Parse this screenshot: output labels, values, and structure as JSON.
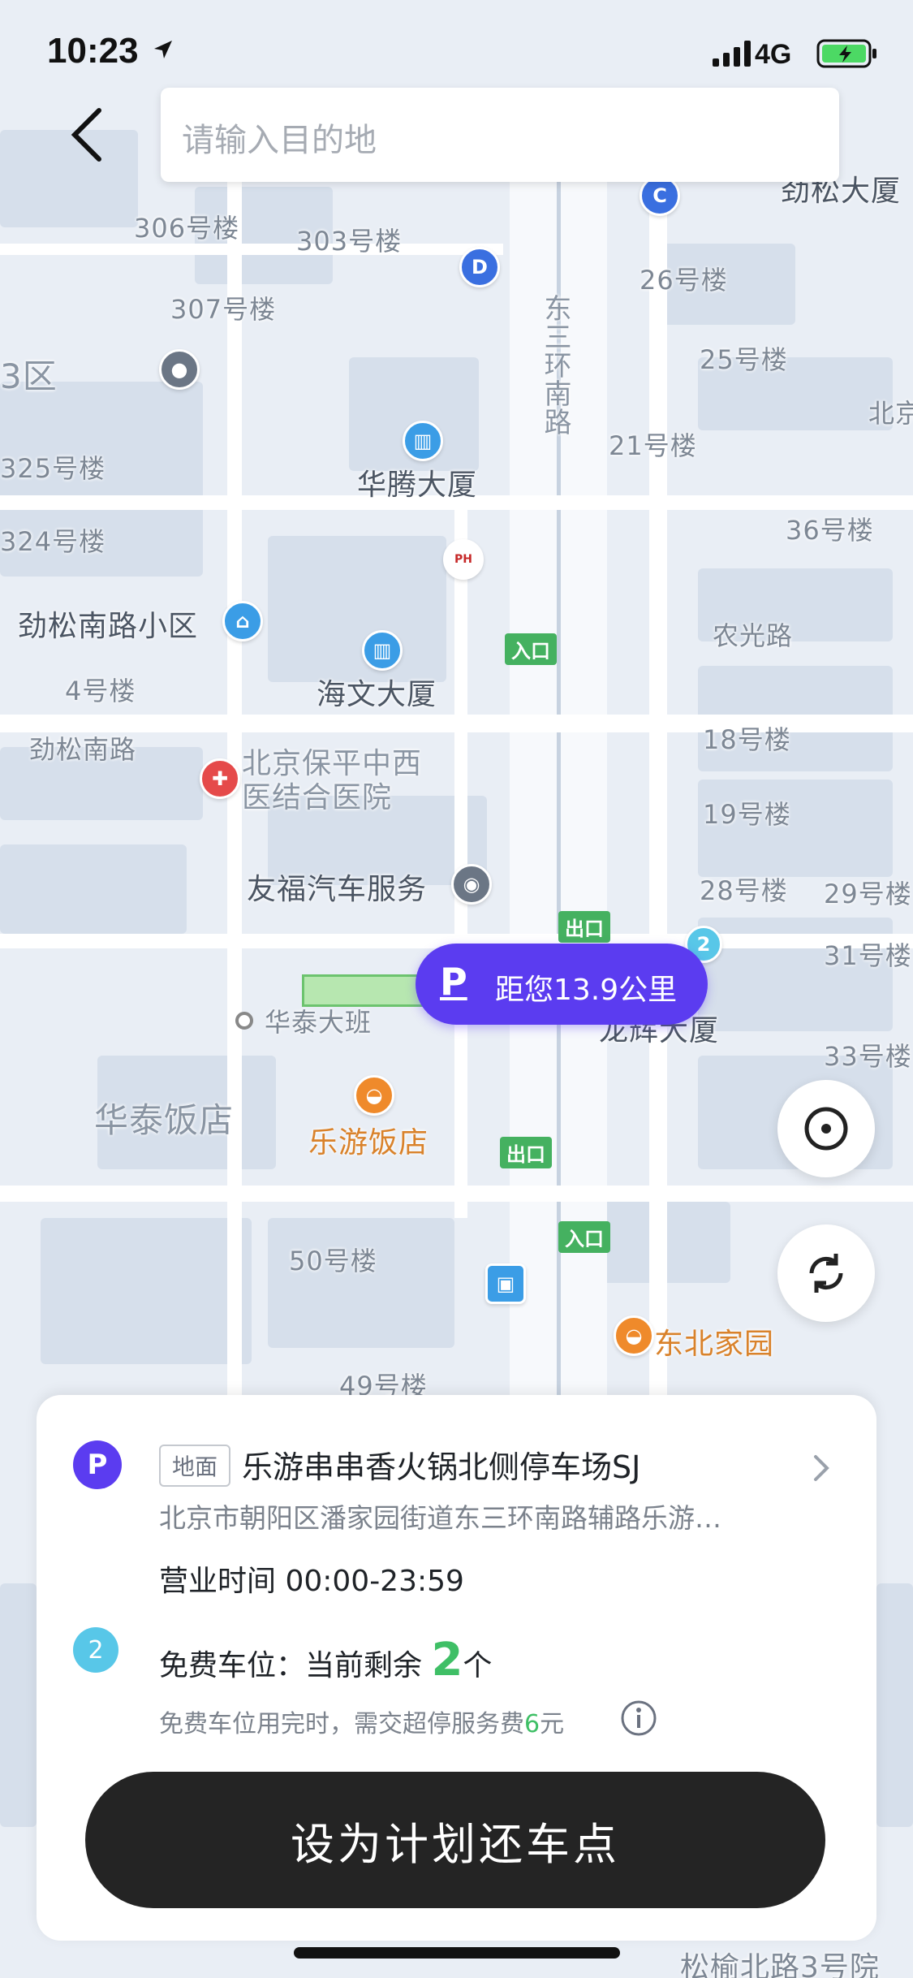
{
  "status_bar": {
    "time": "10:23",
    "network": "4G"
  },
  "search": {
    "placeholder": "请输入目的地"
  },
  "map": {
    "labels": {
      "b306": "306号楼",
      "b303": "303号楼",
      "b307": "307号楼",
      "b26": "26号楼",
      "b25": "25号楼",
      "b21": "21号楼",
      "b325": "325号楼",
      "b324": "324号楼",
      "b36": "36号楼",
      "b4": "4号楼",
      "b18": "18号楼",
      "b19": "19号楼",
      "b28": "28号楼",
      "b29": "29号楼",
      "b31": "31号楼",
      "b33": "33号楼",
      "b50": "50号楼",
      "b49": "49号楼",
      "huateng": "华腾大厦",
      "haiwen": "海文大厦",
      "jingsong_xiaoqu": "劲松南路小区",
      "jingsong_road": "劲松南路",
      "hospital": "北京保平中西医结合医院",
      "youfu": "友福汽车服务",
      "huatai_ban": "华泰大班",
      "huatai_hotel": "华泰饭店",
      "leyou_hotel": "乐游饭店",
      "longhui": "龙辉大厦",
      "nongguang": "农光路",
      "dongbei": "东北家园",
      "jingsong_tower": "劲松大厦",
      "dongsan": "东三环南路",
      "qu3": "3区",
      "songyu": "松榆北路3号院",
      "beijing": "北京"
    },
    "gates": {
      "entrance": "入口",
      "exit": "出口"
    },
    "poi_letters": {
      "c": "C",
      "d": "D"
    },
    "parking_badge": "2",
    "bubble": {
      "icon": "P",
      "distance_text": "距您13.9公里"
    },
    "controls": {
      "locate": "locate-icon",
      "refresh": "refresh-icon"
    }
  },
  "card": {
    "icon": "P",
    "type": "地面",
    "name": "乐游串串香火锅北侧停车场SJ",
    "address": "北京市朝阳区潘家园街道东三环南路辅路乐游…",
    "hours": "营业时间 00:00-23:59",
    "free_badge": "2",
    "free_prefix": "免费车位：当前剩余 ",
    "free_count": "2",
    "free_suffix": "个",
    "fee_prefix": "免费车位用完时，需交超停服务费",
    "fee_amount": "6",
    "fee_suffix": "元",
    "cta_label": "设为计划还车点",
    "colors": {
      "accent": "#5b3cf0",
      "green": "#3fbf66",
      "button": "#242424"
    }
  }
}
